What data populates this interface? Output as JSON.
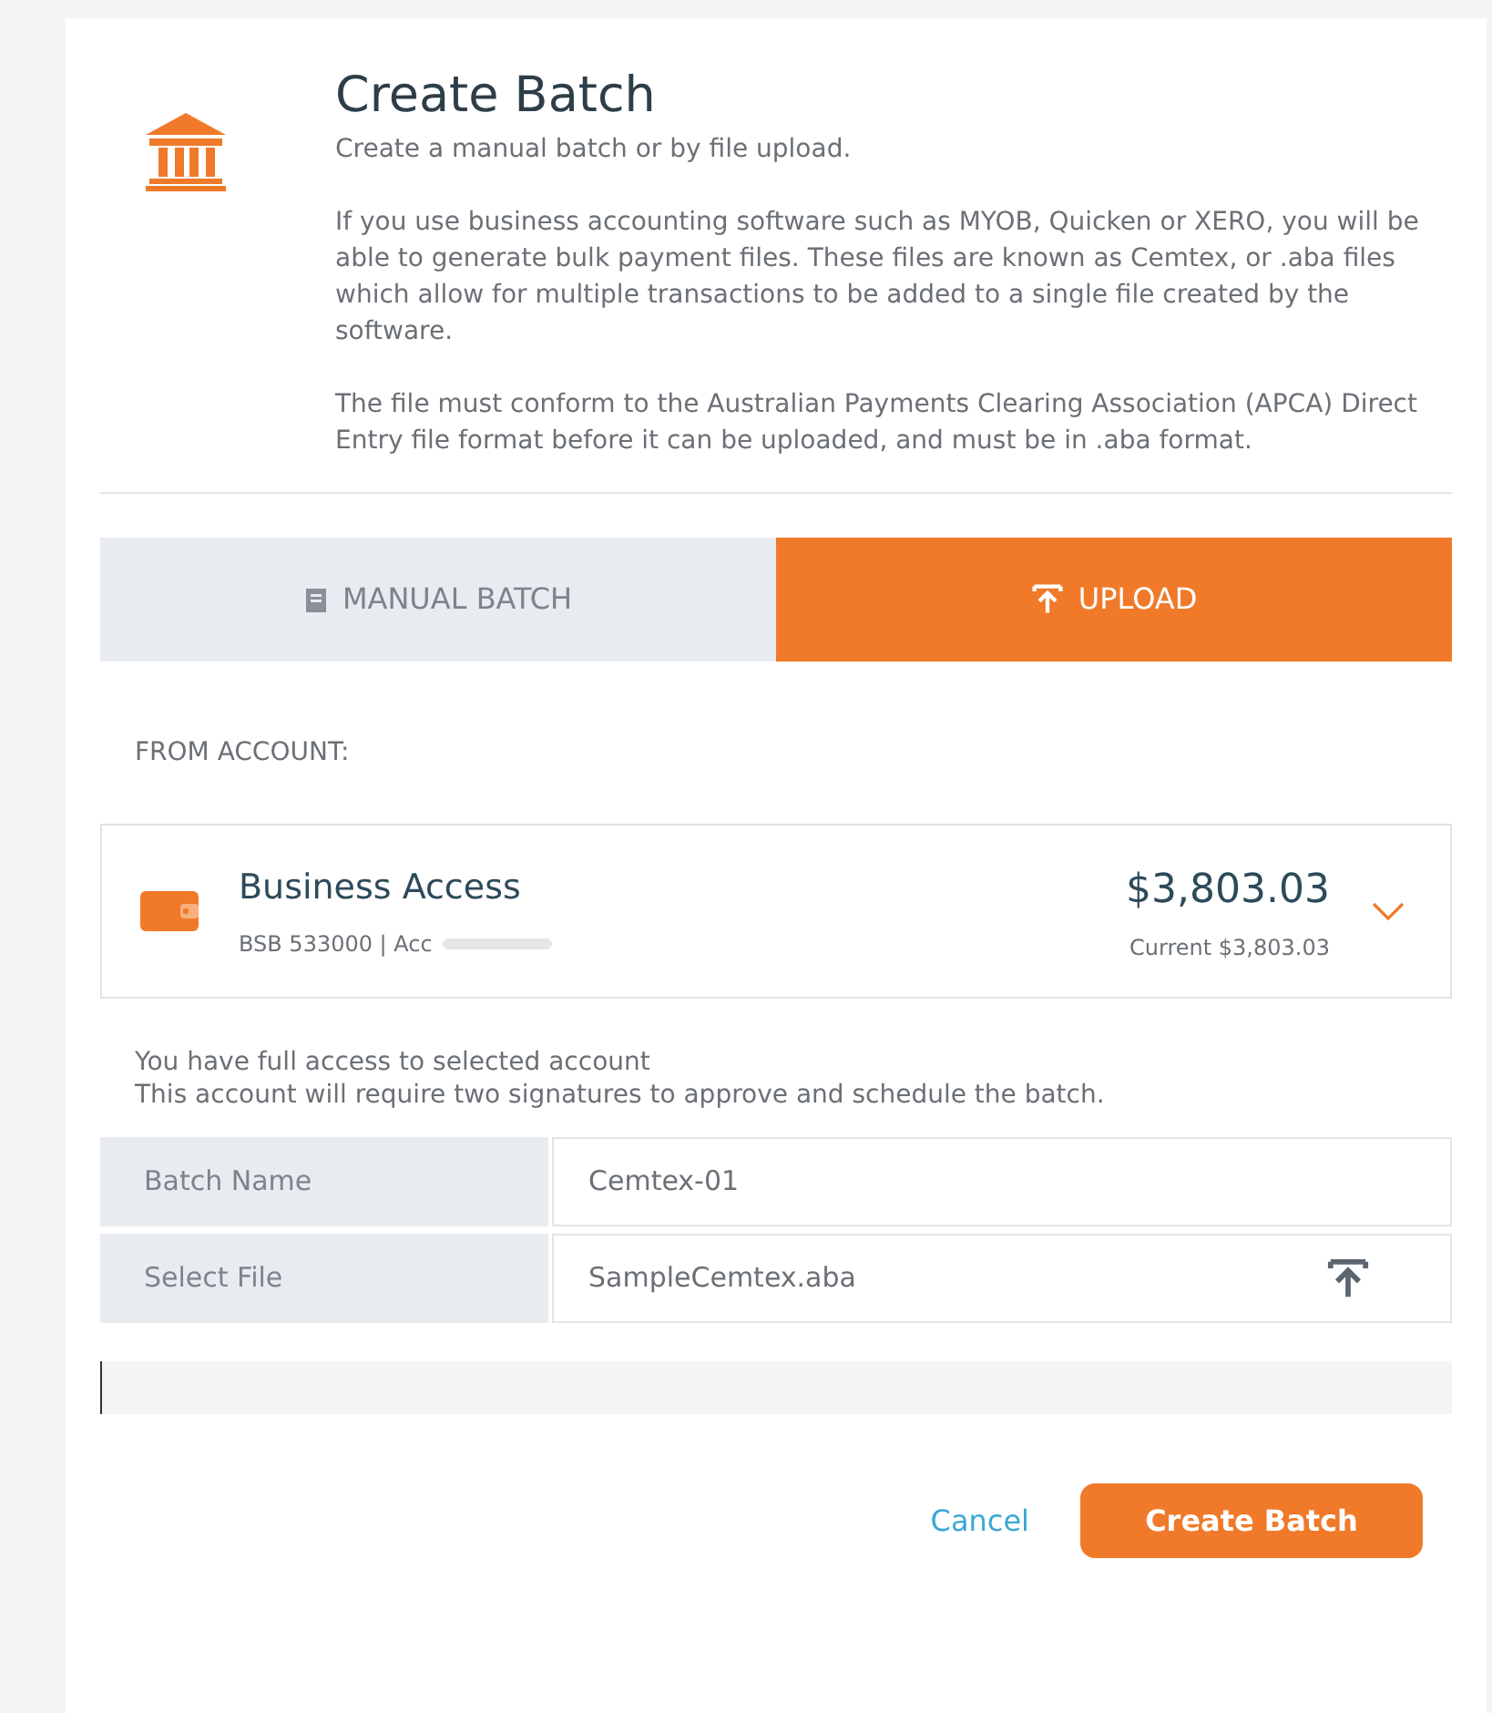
{
  "header": {
    "title": "Create Batch",
    "subtitle": "Create a manual batch or by file upload.",
    "paragraphs": [
      "If you use business accounting software such as MYOB, Quicken or XERO, you will be able to generate bulk payment files. These files are known as Cemtex, or .aba files which allow for multiple transactions to be added to a single file created by the software.",
      "The file must conform to the Australian Payments Clearing Association (APCA) Direct Entry file format before it can be uploaded, and must be in .aba format."
    ]
  },
  "tabs": [
    {
      "label": "MANUAL BATCH",
      "kind": "manual",
      "selected": false
    },
    {
      "label": "UPLOAD",
      "kind": "upload",
      "selected": true
    }
  ],
  "from_account": {
    "label": "FROM ACCOUNT:",
    "name": "Business Access",
    "details": "BSB 533000 | Acc",
    "balance": "$3,803.03",
    "current": "Current $3,803.03"
  },
  "notes": [
    "You have full access to selected account",
    "This account will require two signatures to approve and schedule the batch."
  ],
  "form": [
    {
      "label": "Batch Name",
      "value": "Cemtex-01",
      "kind": "text"
    },
    {
      "label": "Select File",
      "value": "SampleCemtex.aba",
      "kind": "file"
    }
  ],
  "buttons": {
    "cancel": "Cancel",
    "submit": "Create Batch"
  }
}
